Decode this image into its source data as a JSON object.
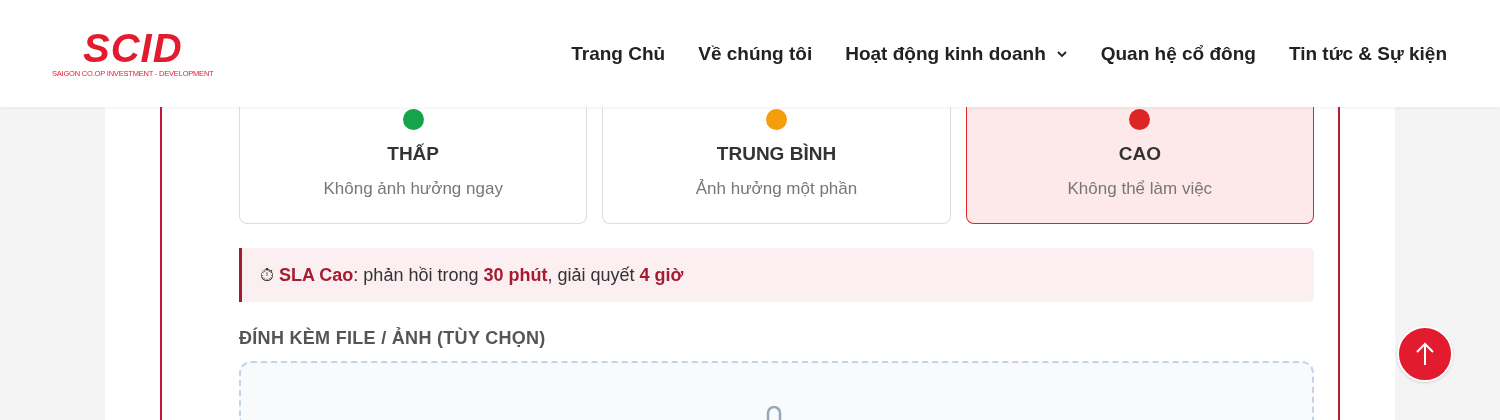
{
  "logo": {
    "name": "SCID",
    "tagline": "SAIGON CO.OP INVESTMENT - DEVELOPMENT"
  },
  "nav": [
    {
      "label": "Trang Chủ",
      "dropdown": false
    },
    {
      "label": "Về chúng tôi",
      "dropdown": false
    },
    {
      "label": "Hoạt động kinh doanh",
      "dropdown": true
    },
    {
      "label": "Quan hệ cổ đông",
      "dropdown": false
    },
    {
      "label": "Tin tức & Sự kiện",
      "dropdown": false
    }
  ],
  "levels": [
    {
      "title": "THẤP",
      "description": "Không ảnh hưởng ngay",
      "color": "#16a34a",
      "selected": false
    },
    {
      "title": "TRUNG BÌNH",
      "description": "Ảnh hưởng một phần",
      "color": "#f59e0b",
      "selected": false
    },
    {
      "title": "CAO",
      "description": "Không thể làm việc",
      "color": "#dc2626",
      "selected": true
    }
  ],
  "sla": {
    "icon": "⏱",
    "text": "**SLA Cao**: phản hồi trong **30 phút**, giải quyết **4 giờ**"
  },
  "attachment": {
    "label": "ĐÍNH KÈM FILE / ẢNH (TÙY CHỌN)"
  }
}
